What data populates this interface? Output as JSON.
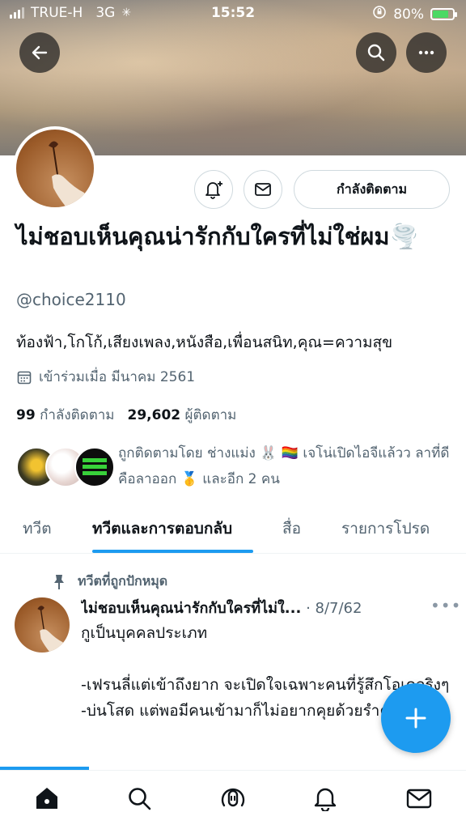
{
  "status_bar": {
    "carrier": "TRUE-H",
    "network": "3G",
    "time": "15:52",
    "battery_percent": "80%",
    "battery_level": 0.8
  },
  "profile": {
    "display_name": "ไม่ชอบเห็นคุณน่ารักกับใครที่ไม่ใช่ผม🌪️",
    "handle": "@choice2110",
    "bio": "ท้องฟ้า,โกโก้,เสียงเพลง,หนังสือ,เพื่อนสนิท,คุณ=ความสุข",
    "joined": "เข้าร่วมเมื่อ มีนาคม 2561",
    "following_count": "99",
    "following_label": "กำลังติดตาม",
    "followers_count": "29,602",
    "followers_label": "ผู้ติดตาม",
    "followed_by": "ถูกติดตามโดย ช่างแม่ง 🐰 🏳️‍🌈 เจโน่เปิดไอจีแล้วว ลาที่ดีคือลาออก 🥇 และอีก 2 คน",
    "follow_button_label": "กำลังติดตาม"
  },
  "tabs": [
    {
      "label": "ทวีต",
      "active": false
    },
    {
      "label": "ทวีตและการตอบกลับ",
      "active": true
    },
    {
      "label": "สื่อ",
      "active": false
    },
    {
      "label": "รายการโปรด",
      "active": false
    }
  ],
  "pinned_tweet": {
    "pinned_label": "ทวีตที่ถูกปักหมุด",
    "author": "ไม่ชอบเห็นคุณน่ารักกับใครที่ไม่ใ...",
    "date": "· 8/7/62",
    "lines": [
      "กูเป็นบุคคลประเภท",
      "",
      "-เฟรนลี่แต่เข้าถึงยาก จะเปิดใจเฉพาะคนที่รู้สึกโอเคจริงๆ",
      "-บ่นโสด แต่พอมีคนเข้ามาก็ไม่อยากคุยด้วยรำคาญ"
    ]
  },
  "icons": {
    "back": "back-arrow-icon",
    "search": "search-icon",
    "more": "more-icon",
    "notify": "bell-plus-icon",
    "message": "envelope-icon",
    "calendar": "calendar-icon",
    "pin": "pin-icon",
    "compose": "plus-icon",
    "nav": [
      "home-icon",
      "search-icon",
      "spaces-icon",
      "bell-icon",
      "mail-icon"
    ]
  },
  "colors": {
    "accent": "#1d9bf0",
    "text_primary": "#0f1419",
    "text_secondary": "#536471"
  }
}
